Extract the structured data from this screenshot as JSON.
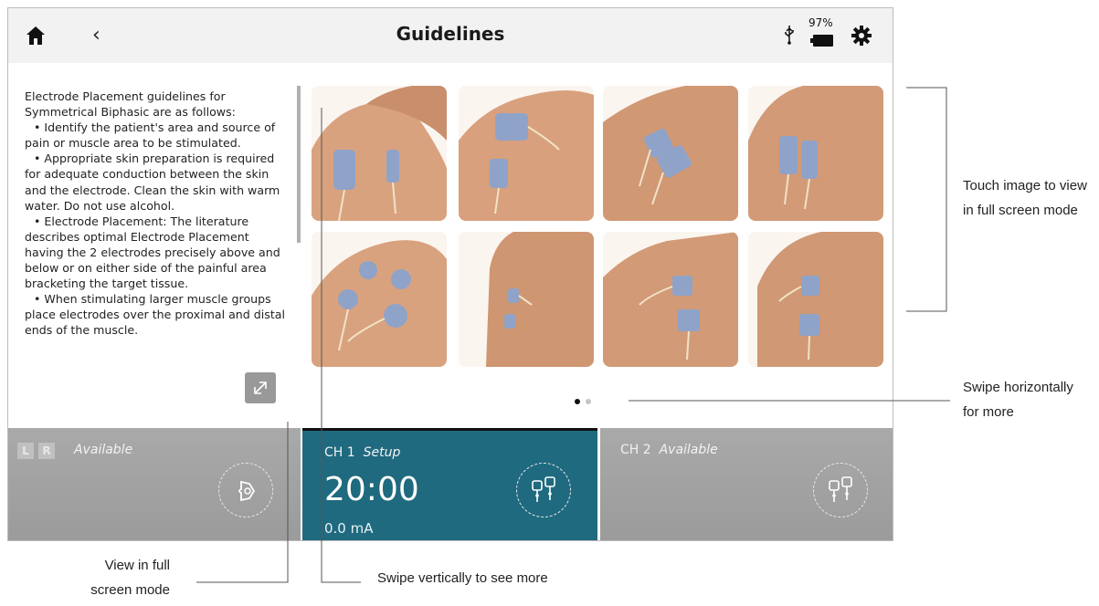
{
  "header": {
    "title": "Guidelines",
    "battery_percent": "97%",
    "icons": [
      "home-icon",
      "back-icon",
      "usb-icon",
      "battery-icon",
      "gear-icon"
    ]
  },
  "guidelines_text": {
    "intro": "Electrode Placement guidelines for Symmetrical Biphasic are as follows:",
    "bullets": [
      "• Identify the patient's area and source of pain or muscle area to be stimulated.",
      "• Appropriate skin preparation is required for adequate conduction between the skin and the electrode. Clean the skin with warm water. Do not use alcohol.",
      "• Electrode Placement: The literature describes optimal Electrode Placement having the 2 electrodes precisely above and below or on either side of the painful area bracketing the target tissue.",
      "• When stimulating larger muscle groups place electrodes over the proximal and distal ends of the muscle."
    ]
  },
  "gallery": {
    "image_count": 8,
    "page_count": 2,
    "current_page": 1
  },
  "channels": {
    "lr": {
      "l": "L",
      "r": "R",
      "status": "Available"
    },
    "ch1": {
      "label": "CH 1",
      "status": "Setup",
      "time": "20:00",
      "current": "0.0 mA"
    },
    "ch2": {
      "label": "CH 2",
      "status": "Available"
    }
  },
  "annotations": {
    "touch_image": [
      "Touch image to view",
      "in full screen mode"
    ],
    "swipe_horizontal": [
      "Swipe horizontally",
      "for more"
    ],
    "view_full": [
      "View in full",
      "screen mode"
    ],
    "swipe_vertical": "Swipe vertically to see more"
  },
  "colors": {
    "active_channel": "#1f6a7f",
    "inactive_channel": "#a3a3a3",
    "header_bg": "#f2f2f2"
  }
}
